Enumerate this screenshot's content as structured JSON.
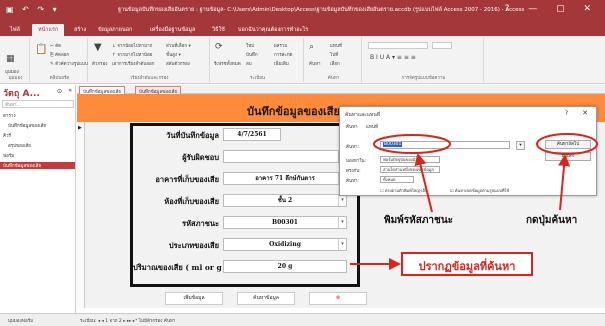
{
  "window": {
    "title": "ฐานข้อมูลบันทึกของเสียอันตราย : ฐานข้อมูล- C:\\Users\\Admin\\Desktop\\Access\\ฐานข้อมูลบันทึกของเสียอันตราย.accdb (รูปแบบไฟล์ Access 2007 - 2016) - Access",
    "qat": "▣ ↶ ↷ ▾",
    "controls": "? — ▢ ✕"
  },
  "ribbon_tabs": [
    "ไฟล์",
    "หน้าแรก",
    "สร้าง",
    "ข้อมูลภายนอก",
    "เครื่องมือฐานข้อมูล",
    "วิธีใช้",
    "บอกฉันว่าคุณต้องการทำอะไร"
  ],
  "ribbon": {
    "groups": [
      {
        "label": "มุมมอง",
        "items": [
          "มุมมอง"
        ]
      },
      {
        "label": "คลิปบอร์ด",
        "items": [
          "✂ ตัด",
          "⎘ คัดลอก",
          "✎ ตัวคัดวางรูปแบบ"
        ]
      },
      {
        "label": "เรียงลำดับและกรอง",
        "items": [
          "ตัวกรอง",
          "↓ จากน้อยไปหามาก",
          "↑ จากมากไปหาน้อย",
          "เอาการเรียงลำดับออก",
          "ส่วนที่เลือก ▾",
          "ขั้นสูง ▾",
          "สลับตัวกรอง"
        ]
      },
      {
        "label": "ระเบียน",
        "items": [
          "รีเฟรชทั้งหมด",
          "ใหม่",
          "บันทึก",
          "ลบ",
          "ผลรวม",
          "การสะกด",
          "เพิ่มเติม"
        ]
      },
      {
        "label": "ค้นหา",
        "items": [
          "ค้นหา",
          "แทนที่",
          "ไปที่",
          "เลือก"
        ]
      },
      {
        "label": "การจัดรูปแบบข้อความ",
        "items": [
          "B  I  U  A ▾  ≡ ≡ ≡"
        ]
      }
    ]
  },
  "nav": {
    "title": "วัตถุ A...",
    "search_placeholder": "ค้นหา...",
    "items": [
      {
        "label": "ตาราง",
        "type": "section"
      },
      {
        "label": "บันทึกข้อมูลของเสีย",
        "type": "item"
      },
      {
        "label": "คิวรี",
        "type": "section"
      },
      {
        "label": "สรุปของเสีย",
        "type": "item"
      },
      {
        "label": "ฟอร์ม",
        "type": "section"
      },
      {
        "label": "บันทึกข้อมูลของเสีย",
        "type": "item",
        "selected": true
      }
    ]
  },
  "doc_tabs": [
    "บันทึกข้อมูลของเสีย",
    "บันทึกข้อมูลของเสีย"
  ],
  "form": {
    "title": "บันทึกข้อมูลของเสีย",
    "fields": [
      {
        "label": "วันที่บันทึกข้อมูล",
        "value": "4/7/2561",
        "dropdown": false
      },
      {
        "label": "ผู้รับผิดชอบ",
        "value": "",
        "dropdown": false
      },
      {
        "label": "อาคารที่เก็บของเสีย",
        "value": "อาคาร 71 ลึกษ์กันตาร",
        "dropdown": true
      },
      {
        "label": "ห้องที่เก็บของเสีย",
        "value": "ชั้น 2",
        "dropdown": true
      },
      {
        "label": "รหัสภาชนะ",
        "value": "B00301",
        "dropdown": true
      },
      {
        "label": "ประเภทของเสีย",
        "value": "Oxidizing",
        "dropdown": true
      },
      {
        "label": "ปริมาณของเสีย ( ml or g )",
        "value": "20 g",
        "dropdown": false
      }
    ],
    "buttons": [
      "เพิ่มข้อมูล",
      "ค้นหาข้อมูล",
      "⊗"
    ]
  },
  "dialog": {
    "title": "ค้นหาและแทนที่",
    "help": "?",
    "close": "✕",
    "tabs_label": "ค้นหา",
    "tab2": "แทนที่",
    "find_label": "ค้นหา:",
    "find_value": "B00301",
    "lookin_label": "มองหาใน:",
    "lookin_value": "ฟอร์มปัจจุบันของฉัน",
    "match_label": "ตรงกับ:",
    "match_value": "ส่วนใดส่วนหนึ่งของเขตข้อมูล",
    "search_label": "ค้นหา:",
    "search_value": "ทั้งหมด",
    "check1": "ตรงตามตัวพิมพ์ใหญ่-เล็ก",
    "check2": "ค้นหาเขตข้อมูลตามรูปแบบที่ใช้",
    "find_next": "ค้นหาถัดไป",
    "cancel": "ยกเลิก"
  },
  "annotations": {
    "type_code": "พิมพ์รหัสภาชนะ",
    "click_search": "กดปุ่มค้นหา",
    "result": "ปรากฏข้อมูลที่ค้นหา"
  },
  "colors": {
    "brand": "#a4373a",
    "header": "#fe8a3c",
    "annotation": "#d9251c"
  },
  "status": {
    "record_nav": "ระเบียน: ◂  ◂ 1 จาก 2  ▸  ▸▸  ▸*   ไม่มีตัวกรอง   ค้นหา",
    "view": "มุมมองฟอร์ม"
  }
}
